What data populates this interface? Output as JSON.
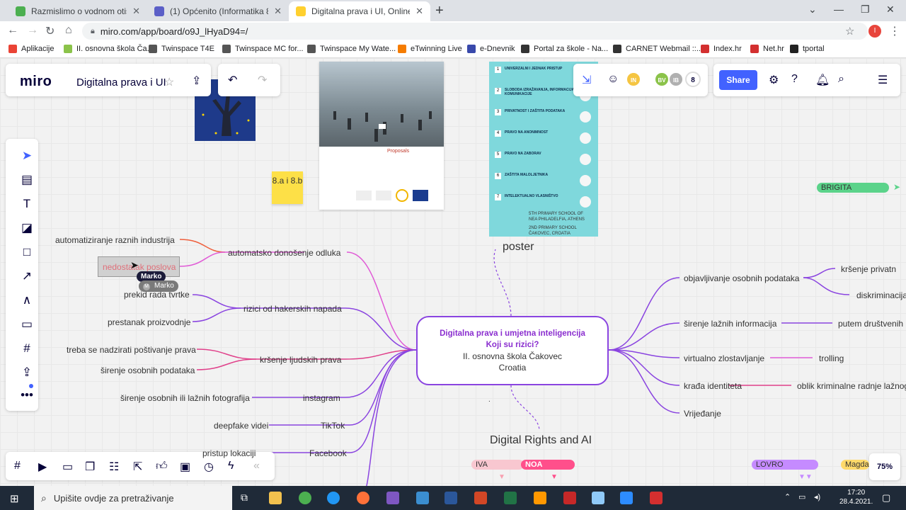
{
  "browser": {
    "tabs": [
      {
        "title": "Razmislimo o vodnom otisku (Pro",
        "color": "#4caf50"
      },
      {
        "title": "(1) Općenito (Informatika 8a | os",
        "color": "#5b5fc7"
      },
      {
        "title": "Digitalna prava i UI, Online White",
        "color": "#ffd02f"
      }
    ],
    "url": "miro.com/app/board/o9J_lHyaD94=/",
    "profile_initial": "I",
    "bookmarks": [
      {
        "label": "Aplikacije",
        "color": "#ea4335"
      },
      {
        "label": "II. osnovna škola Ča...",
        "color": "#8bc34a"
      },
      {
        "label": "Twinspace T4E",
        "color": "#555555"
      },
      {
        "label": "Twinspace MC for...",
        "color": "#555555"
      },
      {
        "label": "Twinspace My Wate...",
        "color": "#555555"
      },
      {
        "label": "eTwinning Live",
        "color": "#f57c00"
      },
      {
        "label": "e-Dnevnik",
        "color": "#3949ab"
      },
      {
        "label": "Portal za škole - Na...",
        "color": "#333333"
      },
      {
        "label": "CARNET Webmail ::...",
        "color": "#333333"
      },
      {
        "label": "Index.hr",
        "color": "#d32f2f"
      },
      {
        "label": "Net.hr",
        "color": "#d32f2f"
      },
      {
        "label": "tportal",
        "color": "#222222"
      }
    ]
  },
  "miro": {
    "logo": "miro",
    "board_title": "Digitalna prava i UI",
    "share_label": "Share",
    "collaborators": [
      {
        "initials": "IN",
        "color": "#f5c542"
      },
      {
        "initials": "BV",
        "color": "#8bc34a"
      },
      {
        "initials": "IB",
        "color": "#b0b0b0"
      }
    ],
    "collaborator_count": "8",
    "zoom": "75%",
    "sticky": "8.a i 8.b",
    "center": {
      "line1": "Digitalna prava i umjetna inteligencija",
      "line2": "Koji su rizici?",
      "line3": "II. osnovna škola Čakovec",
      "line4": "Croatia"
    },
    "poster_label": "poster",
    "digital_rights_label": "Digital Rights and AI",
    "left_branches": [
      {
        "label": "automatsko donošenje odluka",
        "children": [
          "automatiziranje raznih industrija",
          "nedostatak poslova"
        ]
      },
      {
        "label": "rizici od hakerskih napada",
        "children": [
          "prekid rada tvrtke",
          "prestanak proizvodnje"
        ]
      },
      {
        "label": "kršenje ljudskih prava",
        "children": [
          "treba se nadzirati poštivanje prava",
          "širenje osobnih podataka"
        ]
      },
      {
        "label": "instagram",
        "children": [
          "širenje osobnih ili lažnih fotografija"
        ]
      },
      {
        "label": "TikTok",
        "children": [
          "deepfake videi"
        ]
      },
      {
        "label": "Facebook",
        "children": [
          "pristup lokaciji"
        ]
      }
    ],
    "right_branches": [
      {
        "label": "objavljivanje osobnih podataka",
        "children": [
          "kršenje privatn",
          "diskriminacija"
        ]
      },
      {
        "label": "širenje lažnih informacija",
        "children": [
          "putem društvenih"
        ]
      },
      {
        "label": "virtualno zlostavljanje",
        "children": [
          "trolling"
        ]
      },
      {
        "label": "krađa identiteta",
        "children": [
          "oblik kriminalne radnje lažnog"
        ]
      },
      {
        "label": "Vrijeđanje",
        "children": []
      }
    ],
    "cursor_label": "Marko",
    "cursor_label_small": "Marko",
    "image_caption": "Proposals",
    "poster_items": [
      "UNIVERZALNI I JEDNAK PRISTUP",
      "SLOBODA IZRAŽAVANJA, INFORMACIJA, KOMUNIKACIJE",
      "PRIVATNOST I ZAŠTITA PODATAKA",
      "PRAVO NA ANONIMNOST",
      "PRAVO NA ZABORAV",
      "ZAŠTITA MALOLJETNIKA",
      "INTELEKTUALNO VLASNIŠTVO"
    ],
    "poster_footer": [
      "5TH PRIMARY SCHOOL OF",
      "NEA PHILADELFIA, ATHENS",
      "2ND PRIMARY SCHOOL",
      "ČAKOVEC, CROATIA"
    ],
    "name_tags": [
      {
        "label": "BRIGITA",
        "color": "#5bd38a"
      },
      {
        "label": "IVA",
        "color": "#f8c7d0"
      },
      {
        "label": "NOA",
        "color": "#ff4f8b"
      },
      {
        "label": "LOVRO",
        "color": "#c58bff"
      },
      {
        "label": "Magda",
        "color": "#ffd96a"
      }
    ]
  },
  "taskbar": {
    "search_placeholder": "Upišite ovdje za pretraživanje",
    "time": "17:20",
    "date": "28.4.2021."
  }
}
